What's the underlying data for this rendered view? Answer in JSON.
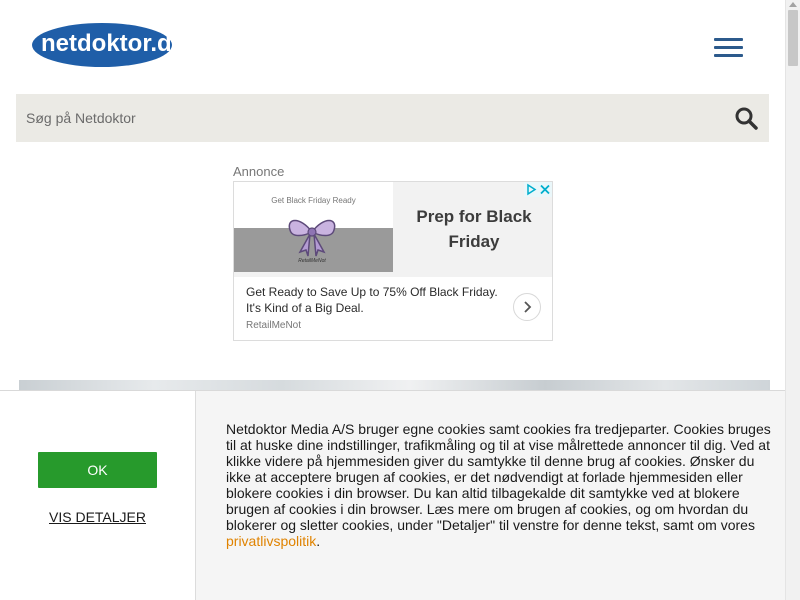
{
  "header": {
    "logo_text": "netdoktor.dk",
    "menu_icon": "hamburger-menu-icon"
  },
  "search": {
    "placeholder": "Søg på Netdoktor",
    "icon": "search-icon"
  },
  "ad": {
    "label": "Annonce",
    "image_caption": "Get Black Friday Ready",
    "image_logo_text": "RetailMeNot",
    "headline": "Prep for Black Friday",
    "body": "Get Ready to Save Up to 75% Off Black Friday. It's Kind of a Big Deal.",
    "source": "RetailMeNot",
    "next_icon": "chevron-right-icon",
    "badge_icons": [
      "adchoices-icon",
      "close-icon"
    ]
  },
  "cookie_banner": {
    "ok_label": "OK",
    "details_label": "VIS DETALJER",
    "text": "Netdoktor Media A/S bruger egne cookies samt cookies fra tredjeparter. Cookies bruges til at huske dine indstillinger, trafikmåling og til at vise målrettede annoncer til dig. Ved at klikke videre på hjemmesiden giver du samtykke til denne brug af cookies. Ønsker du ikke at acceptere brugen af cookies, er det nødvendigt at forlade hjemmesiden eller blokere cookies i din browser. Du kan altid tilbagekalde dit samtykke ved at blokere brugen af cookies i din browser. Læs mere om brugen af cookies, og om hvordan du blokerer og sletter cookies, under \"Detaljer\" til venstre for denne tekst, samt om vores ",
    "link_text": "privatlivspolitik",
    "text_end": "."
  },
  "colors": {
    "brand_blue": "#1f5ea8",
    "ok_green": "#279a2c",
    "link_orange": "#e08300",
    "search_bg": "#ebeae5"
  }
}
